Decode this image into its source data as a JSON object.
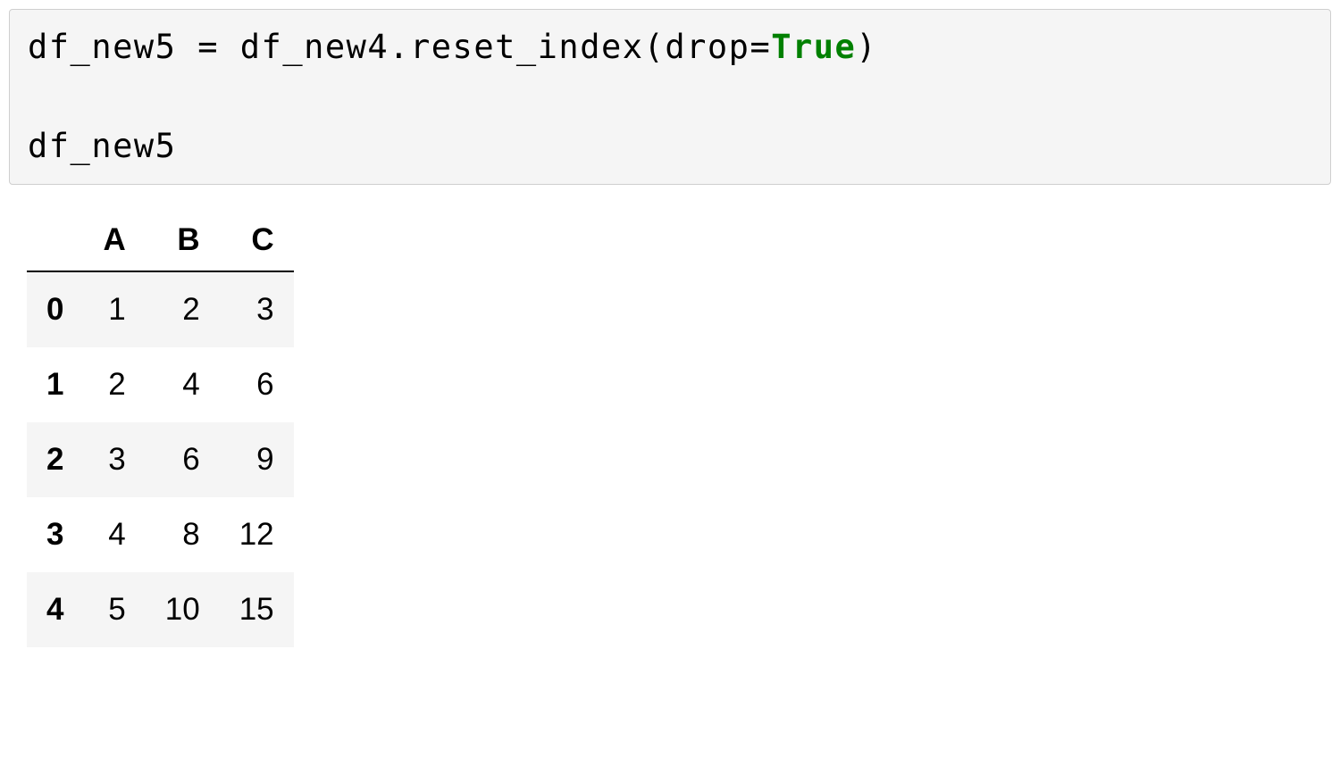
{
  "code": {
    "t1": "df_new5 ",
    "op1": "=",
    "t2": " df_new4",
    "dot": ".",
    "method": "reset_index",
    "lp": "(",
    "arg": "drop",
    "eq": "=",
    "val": "True",
    "rp": ")",
    "line2": "df_new5"
  },
  "table": {
    "idx_header": "",
    "columns": [
      "A",
      "B",
      "C"
    ],
    "index": [
      "0",
      "1",
      "2",
      "3",
      "4"
    ],
    "rows": [
      [
        "1",
        "2",
        "3"
      ],
      [
        "2",
        "4",
        "6"
      ],
      [
        "3",
        "6",
        "9"
      ],
      [
        "4",
        "8",
        "12"
      ],
      [
        "5",
        "10",
        "15"
      ]
    ]
  }
}
